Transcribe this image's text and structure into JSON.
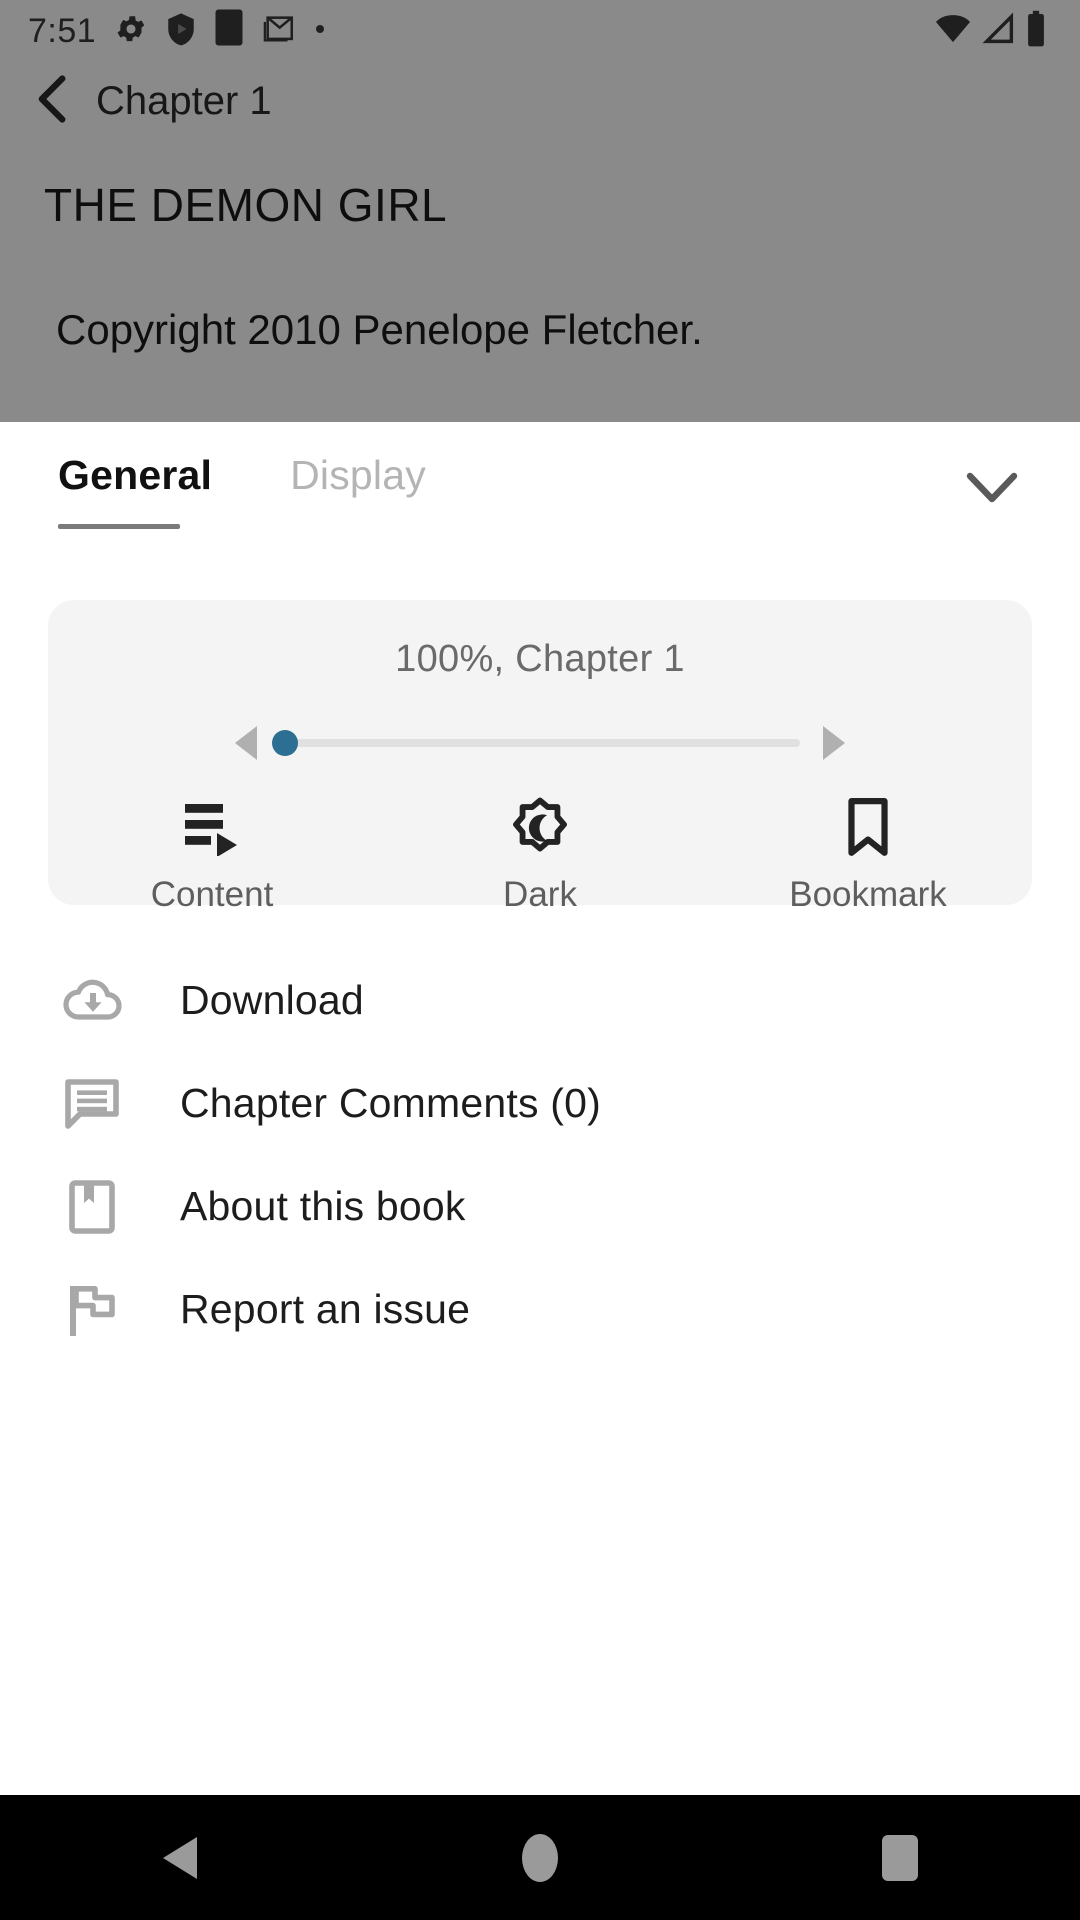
{
  "status_bar": {
    "time": "7:51",
    "left_icons": [
      "settings-gear-icon",
      "shield-play-icon",
      "square-app-icon",
      "gmail-icon",
      "dot-icon"
    ],
    "right_icons": [
      "wifi-icon",
      "cellular-signal-icon",
      "battery-icon"
    ]
  },
  "app_bar": {
    "back_label": "back-arrow-icon",
    "title": "Chapter 1"
  },
  "reader": {
    "book_title": "THE DEMON GIRL",
    "copyright": "Copyright 2010 Penelope Fletcher."
  },
  "sheet": {
    "tabs": [
      {
        "label": "General",
        "active": true
      },
      {
        "label": "Display",
        "active": false
      }
    ],
    "collapse_icon": "chevron-down-icon",
    "progress_card": {
      "label": "100%, Chapter 1",
      "percent": 100,
      "chapter": "Chapter 1",
      "slider_value": 0,
      "slider_min": 0,
      "slider_max": 100,
      "prev_icon": "triangle-left-icon",
      "next_icon": "triangle-right-icon",
      "thumb_color": "#2d6e93",
      "quick_actions": [
        {
          "label": "Content",
          "icon": "table-of-contents-icon"
        },
        {
          "label": "Dark",
          "icon": "dark-mode-icon"
        },
        {
          "label": "Bookmark",
          "icon": "bookmark-icon"
        }
      ]
    },
    "menu_items": [
      {
        "label": "Download",
        "icon": "cloud-download-icon"
      },
      {
        "label": "Chapter Comments (0)",
        "icon": "comment-lines-icon"
      },
      {
        "label": "About this book",
        "icon": "book-info-icon"
      },
      {
        "label": "Report an issue",
        "icon": "flag-icon"
      }
    ]
  },
  "nav_bar": {
    "back": "nav-back-icon",
    "home": "nav-home-icon",
    "recents": "nav-recents-icon"
  }
}
